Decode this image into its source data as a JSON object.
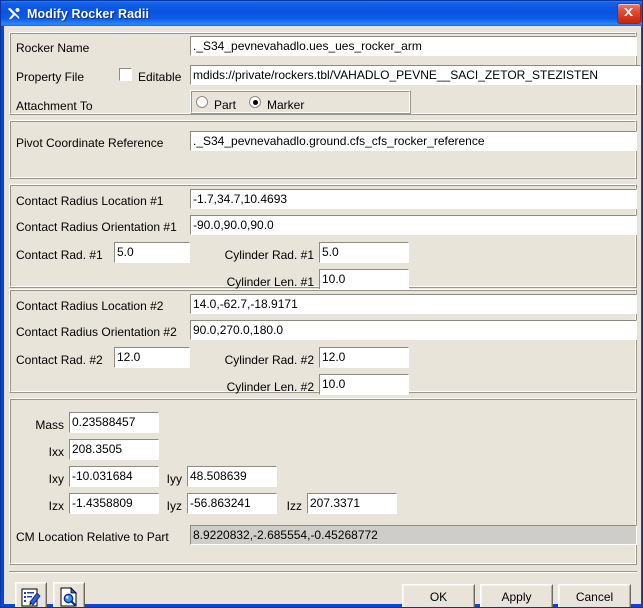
{
  "window": {
    "title": "Modify Rocker Radii",
    "title_icon": "crossed-tools-icon",
    "close_icon": "close-icon",
    "accent_color": "#0a52e0",
    "face_color": "#e9e4d9"
  },
  "form": {
    "rocker_name": {
      "label": "Rocker Name",
      "value": "._S34_pevnevahadlo.ues_ues_rocker_arm"
    },
    "property_file": {
      "label": "Property File",
      "editable_label": "Editable",
      "editable_checked": false,
      "value": "mdids://private/rockers.tbl/VAHADLO_PEVNE__SACI_ZETOR_STEZISTEN"
    },
    "attachment_to": {
      "label": "Attachment To",
      "options": [
        "Part",
        "Marker"
      ],
      "selected": "Marker"
    },
    "pivot_coordinate_reference": {
      "label": "Pivot Coordinate Reference",
      "value": "._S34_pevnevahadlo.ground.cfs_cfs_rocker_reference"
    },
    "contact1": {
      "location_label": "Contact Radius Location #1",
      "location_value": "-1.7,34.7,10.4693",
      "orientation_label": "Contact Radius Orientation #1",
      "orientation_value": "-90.0,90.0,90.0",
      "contact_rad_label": "Contact Rad. #1",
      "contact_rad_value": "5.0",
      "cyl_rad_label": "Cylinder Rad. #1",
      "cyl_rad_value": "5.0",
      "cyl_len_label": "Cylinder Len. #1",
      "cyl_len_value": "10.0"
    },
    "contact2": {
      "location_label": "Contact Radius Location #2",
      "location_value": "14.0,-62.7,-18.9171",
      "orientation_label": "Contact Radius Orientation #2",
      "orientation_value": "90.0,270.0,180.0",
      "contact_rad_label": "Contact Rad. #2",
      "contact_rad_value": "12.0",
      "cyl_rad_label": "Cylinder Rad. #2",
      "cyl_rad_value": "12.0",
      "cyl_len_label": "Cylinder Len. #2",
      "cyl_len_value": "10.0"
    },
    "mass_properties": {
      "mass_label": "Mass",
      "mass_value": "0.23588457",
      "ixx_label": "Ixx",
      "ixx_value": "208.3505",
      "ixy_label": "Ixy",
      "ixy_value": "-10.031684",
      "iyy_label": "Iyy",
      "iyy_value": "48.508639",
      "izx_label": "Izx",
      "izx_value": "-1.4358809",
      "iyz_label": "Iyz",
      "iyz_value": "-56.863241",
      "izz_label": "Izz",
      "izz_value": "207.3371"
    },
    "cm_location": {
      "label": "CM Location Relative to Part",
      "value": "8.9220832,-2.685554,-0.45268772"
    }
  },
  "footer": {
    "edit_icon": "edit-document-icon",
    "info_icon": "document-search-icon",
    "ok_label": "OK",
    "apply_label": "Apply",
    "cancel_label": "Cancel"
  }
}
